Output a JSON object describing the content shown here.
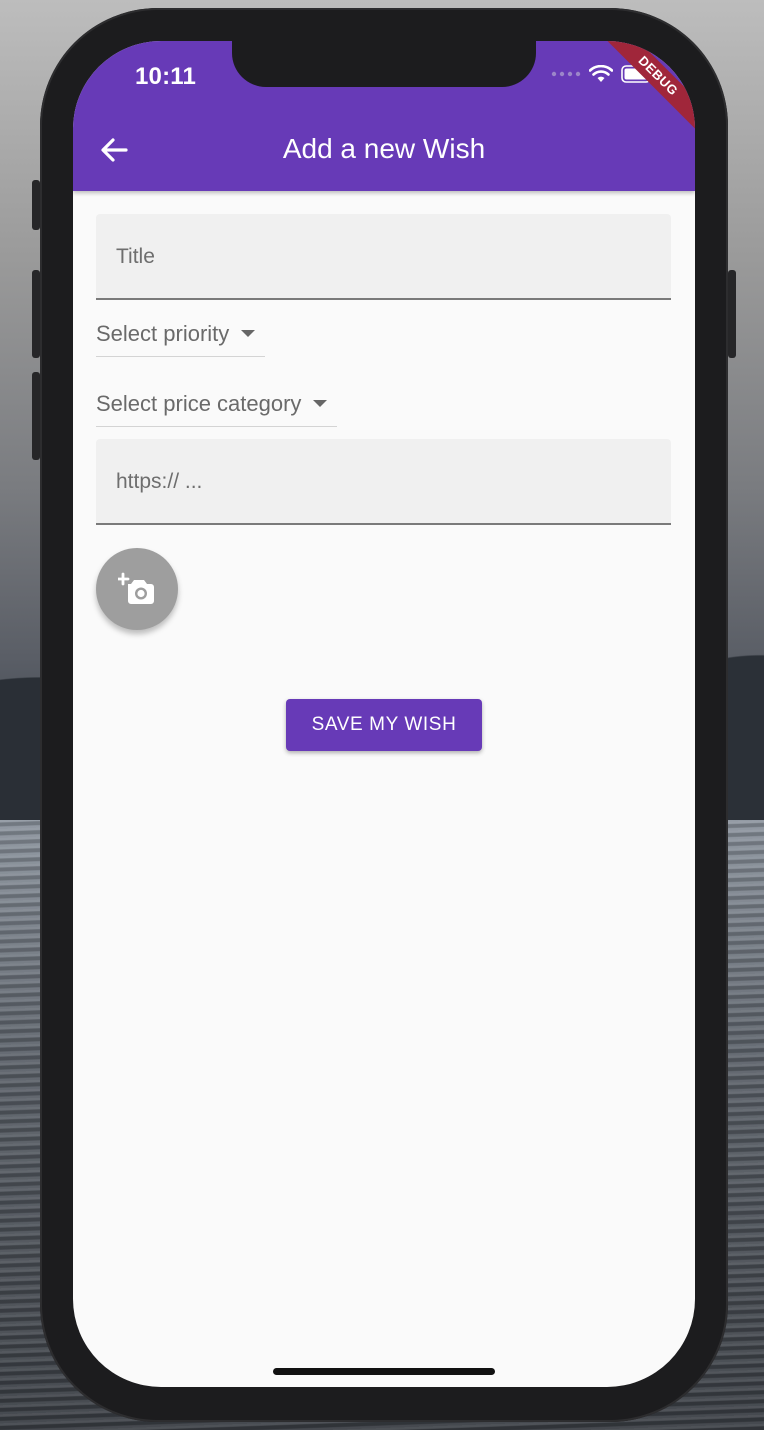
{
  "status_bar": {
    "time": "10:11"
  },
  "debug_banner": "DEBUG",
  "app_bar": {
    "title": "Add a new Wish",
    "back_icon": "arrow-back-icon"
  },
  "form": {
    "title_placeholder": "Title",
    "priority_label": "Select priority",
    "price_category_label": "Select price category",
    "url_placeholder": "https:// ...",
    "camera_icon": "add-a-photo-icon",
    "save_label": "SAVE MY WISH"
  },
  "colors": {
    "primary": "#673ab7",
    "debug": "#a0263a",
    "fab": "#9e9e9e"
  }
}
